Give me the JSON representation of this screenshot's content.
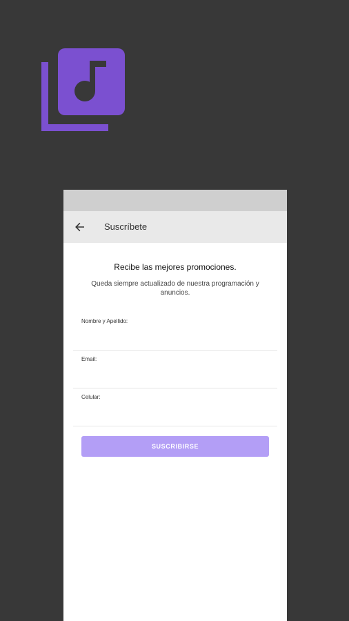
{
  "colors": {
    "background": "#383838",
    "brand": "#7b50d0",
    "button": "#b39ef6",
    "status_bar": "#cfcfcf",
    "app_bar": "#e9e9e9"
  },
  "logo": {
    "icon": "music-library-icon"
  },
  "app_bar": {
    "back_icon": "arrow-back-icon",
    "title": "Suscríbete"
  },
  "form": {
    "headline": "Recibe las mejores promociones.",
    "subtext": "Queda siempre actualizado de nuestra programación y anuncios.",
    "fields": [
      {
        "label": "Nombre y Apellido:",
        "value": ""
      },
      {
        "label": "Email:",
        "value": ""
      },
      {
        "label": "Celular:",
        "value": ""
      }
    ],
    "submit_label": "SUSCRIBIRSE"
  }
}
